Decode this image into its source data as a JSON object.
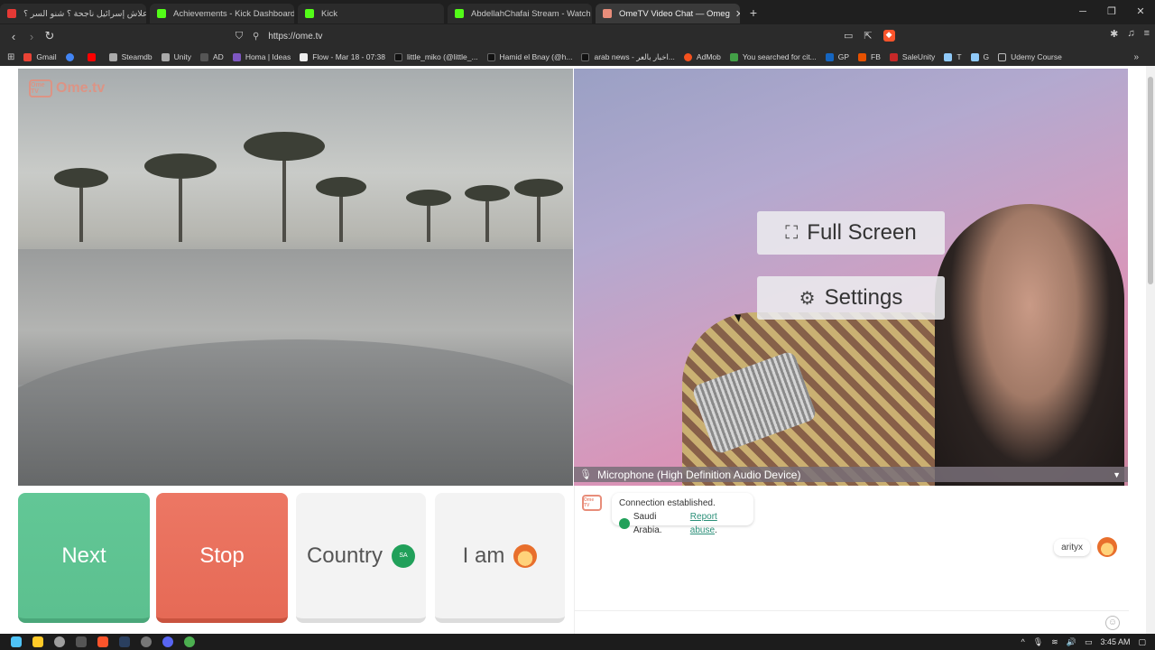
{
  "tabs": [
    {
      "label": "علاش إسرائيل ناجحة ؟ شنو السر ؟ ibe -",
      "color": "#e53935",
      "active": false
    },
    {
      "label": "Achievements - Kick Dashboard",
      "color": "#53fc18",
      "active": false
    },
    {
      "label": "Kick",
      "color": "#53fc18",
      "active": false
    },
    {
      "label": "AbdellahChafai Stream - Watch I",
      "color": "#53fc18",
      "active": false
    },
    {
      "label": "OmeTV Video Chat — Omeg",
      "color": "#e88d7a",
      "active": true
    }
  ],
  "address": {
    "url": "https://ome.tv"
  },
  "bookmarks": [
    {
      "label": "Gmail",
      "color": "#ea4335"
    },
    {
      "label": "",
      "color": "#4285f4"
    },
    {
      "label": "",
      "color": "#ff0000"
    },
    {
      "label": "Steamdb",
      "color": "#aaaaaa"
    },
    {
      "label": "Unity",
      "color": "#aaaaaa"
    },
    {
      "label": "AD",
      "color": "#555555"
    },
    {
      "label": "Homa | Ideas",
      "color": "#7e57c2"
    },
    {
      "label": "Flow - Mar 18 - 07:38",
      "color": "#eeeeee"
    },
    {
      "label": "little_miko (@little_...",
      "color": "#111111"
    },
    {
      "label": "Hamid el Bnay (@h...",
      "color": "#111111"
    },
    {
      "label": "arab news - اخبار بالعر...",
      "color": "#111111"
    },
    {
      "label": "AdMob",
      "color": "#f4511e"
    },
    {
      "label": "You searched for cit...",
      "color": "#43a047"
    },
    {
      "label": "GP",
      "color": "#1565c0"
    },
    {
      "label": "FB",
      "color": "#e65100"
    },
    {
      "label": "SaleUnity",
      "color": "#c62828"
    },
    {
      "label": "T",
      "color": "#90caf9"
    },
    {
      "label": "G",
      "color": "#90caf9"
    },
    {
      "label": "Udemy Course",
      "color": "#bdbdbd"
    }
  ],
  "site": {
    "logo": "Ome.tv",
    "logo_box": "Ome TV"
  },
  "overlay": {
    "fullscreen": "Full Screen",
    "settings": "Settings"
  },
  "mic": {
    "label": "Microphone (High Definition Audio Device)"
  },
  "buttons": {
    "next": "Next",
    "stop": "Stop",
    "country": "Country",
    "iam": "I am",
    "flag_text": "SA"
  },
  "chat": {
    "connection": "Connection established.",
    "country": "Saudi Arabia.",
    "report": "Report abuse",
    "after_report": ".",
    "user_name": "arityx",
    "input_placeholder": ""
  },
  "taskbar": {
    "time": "3:45 AM"
  }
}
